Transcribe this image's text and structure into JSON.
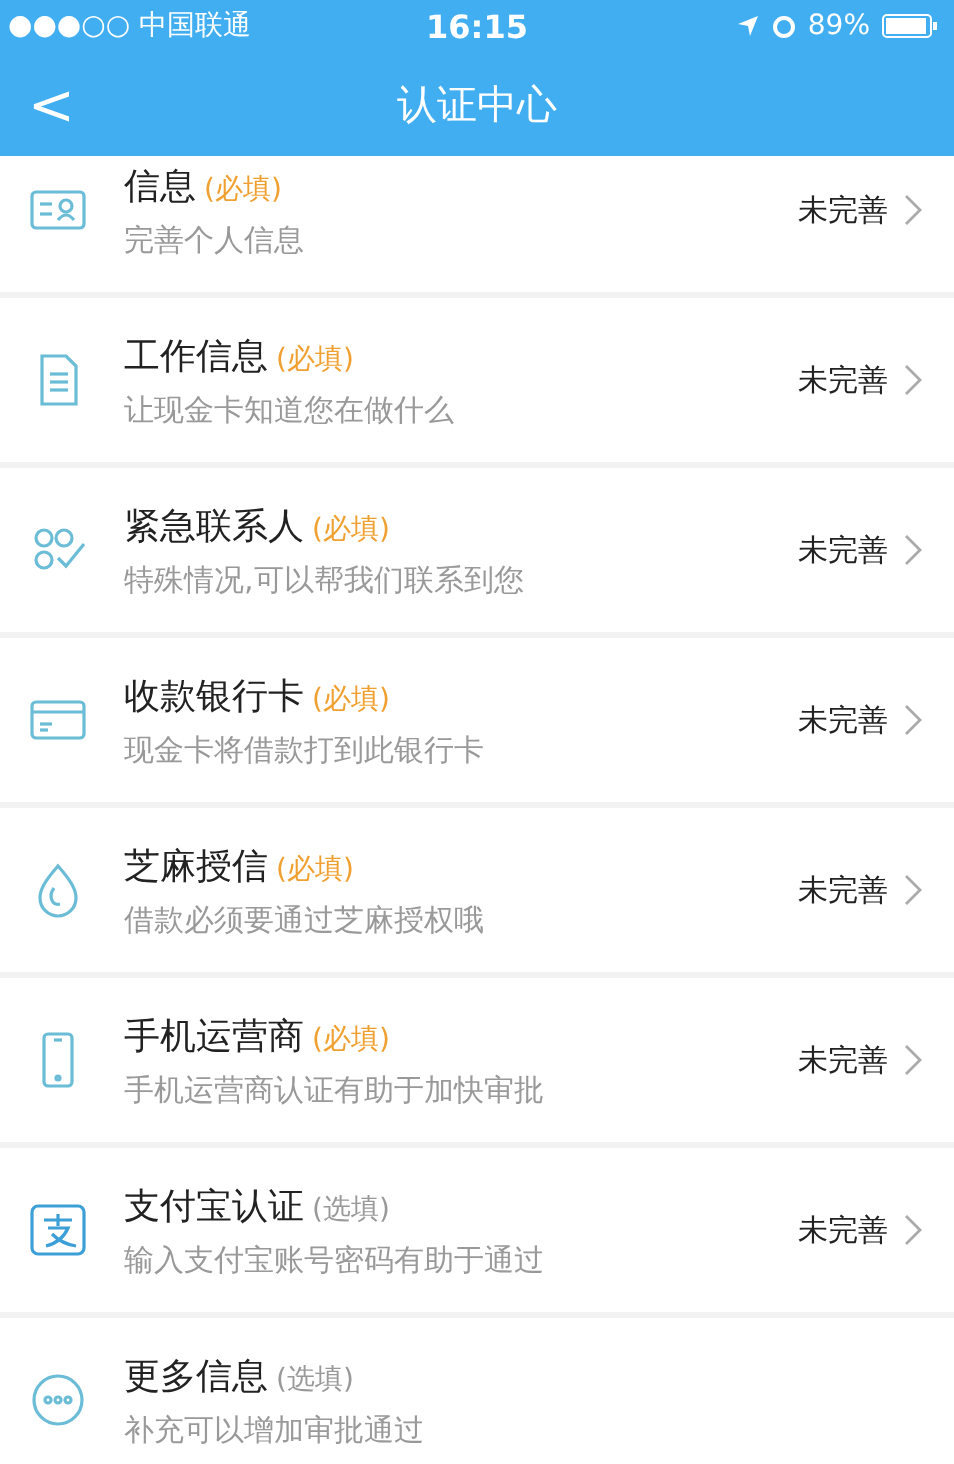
{
  "status_bar": {
    "carrier": "●●●○○ 中国联通",
    "time": "16:15",
    "battery": "89%"
  },
  "nav": {
    "back": "<",
    "title": "认证中心"
  },
  "items": [
    {
      "title": "信息",
      "tag": "(必填)",
      "required": true,
      "subtitle": "完善个人信息",
      "status": "未完善"
    },
    {
      "title": "工作信息",
      "tag": "(必填)",
      "required": true,
      "subtitle": "让现金卡知道您在做什么",
      "status": "未完善"
    },
    {
      "title": "紧急联系人",
      "tag": "(必填)",
      "required": true,
      "subtitle": "特殊情况,可以帮我们联系到您",
      "status": "未完善"
    },
    {
      "title": "收款银行卡",
      "tag": "(必填)",
      "required": true,
      "subtitle": "现金卡将借款打到此银行卡",
      "status": "未完善"
    },
    {
      "title": "芝麻授信",
      "tag": "(必填)",
      "required": true,
      "subtitle": "借款必须要通过芝麻授权哦",
      "status": "未完善"
    },
    {
      "title": "手机运营商",
      "tag": "(必填)",
      "required": true,
      "subtitle": "手机运营商认证有助于加快审批",
      "status": "未完善"
    },
    {
      "title": "支付宝认证",
      "tag": "(选填)",
      "required": false,
      "subtitle": "输入支付宝账号密码有助于通过",
      "status": "未完善"
    },
    {
      "title": "更多信息",
      "tag": "(选填)",
      "required": false,
      "subtitle": "补充可以增加审批通过"
    }
  ]
}
